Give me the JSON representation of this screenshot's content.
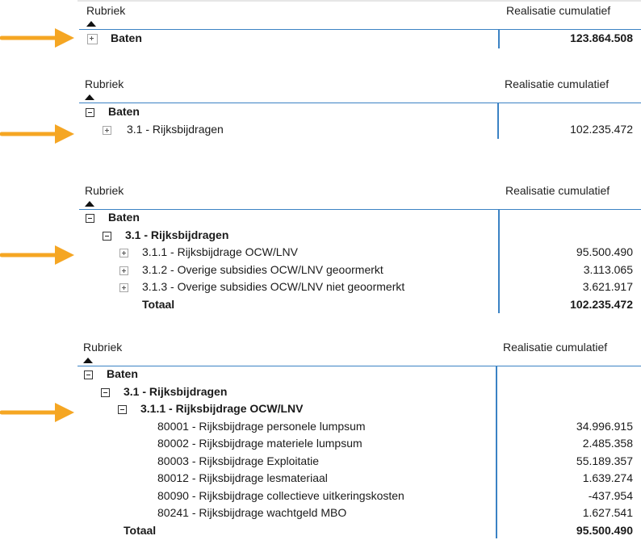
{
  "colors": {
    "accent_line": "#3b82c4",
    "arrow": "#f5a623"
  },
  "icons": {
    "collapsed": "expand-plus-icon",
    "expanded": "collapse-minus-icon",
    "sort": "sort-ascending-icon",
    "pointer": "arrow-right-icon"
  },
  "header": {
    "rubriek": "Rubriek",
    "realisatie": "Realisatie cumulatief"
  },
  "panels": [
    {
      "rows": [
        {
          "label": "Baten",
          "value": "123.864.508",
          "bold": true,
          "value_bold": true,
          "toggle": "plus"
        }
      ]
    },
    {
      "rows": [
        {
          "label": "Baten",
          "value": "",
          "bold": true,
          "toggle": "minus"
        },
        {
          "label": "3.1 - Rijksbijdragen",
          "value": "102.235.472",
          "bold": false,
          "toggle": "plus"
        }
      ]
    },
    {
      "rows": [
        {
          "label": "Baten",
          "value": "",
          "bold": true,
          "toggle": "minus"
        },
        {
          "label": "3.1 - Rijksbijdragen",
          "value": "",
          "bold": true,
          "toggle": "minus"
        },
        {
          "label": "3.1.1 - Rijksbijdrage OCW/LNV",
          "value": "95.500.490",
          "bold": false,
          "toggle": "plus"
        },
        {
          "label": "3.1.2 - Overige subsidies OCW/LNV geoormerkt",
          "value": "3.113.065",
          "bold": false,
          "toggle": "plus"
        },
        {
          "label": "3.1.3 - Overige subsidies OCW/LNV niet geoormerkt",
          "value": "3.621.917",
          "bold": false,
          "toggle": "plus"
        },
        {
          "label": "Totaal",
          "value": "102.235.472",
          "bold": true,
          "value_bold": true,
          "toggle": "none"
        }
      ]
    },
    {
      "rows": [
        {
          "label": "Baten",
          "value": "",
          "bold": true,
          "toggle": "minus"
        },
        {
          "label": "3.1 - Rijksbijdragen",
          "value": "",
          "bold": true,
          "toggle": "minus"
        },
        {
          "label": "3.1.1 - Rijksbijdrage OCW/LNV",
          "value": "",
          "bold": true,
          "toggle": "minus"
        },
        {
          "label": "80001 - Rijksbijdrage personele lumpsum",
          "value": "34.996.915",
          "bold": false,
          "toggle": "none"
        },
        {
          "label": "80002 - Rijksbijdrage materiele lumpsum",
          "value": "2.485.358",
          "bold": false,
          "toggle": "none"
        },
        {
          "label": "80003 - Rijksbijdrage Exploitatie",
          "value": "55.189.357",
          "bold": false,
          "toggle": "none"
        },
        {
          "label": "80012 - Rijksbijdrage lesmateriaal",
          "value": "1.639.274",
          "bold": false,
          "toggle": "none"
        },
        {
          "label": "80090 - Rijksbijdrage collectieve uitkeringskosten",
          "value": "-437.954",
          "bold": false,
          "toggle": "none"
        },
        {
          "label": "80241 - Rijksbijdrage wachtgeld MBO",
          "value": "1.627.541",
          "bold": false,
          "toggle": "none"
        },
        {
          "label": "Totaal",
          "value": "95.500.490",
          "bold": true,
          "value_bold": true,
          "toggle": "none"
        }
      ]
    }
  ]
}
